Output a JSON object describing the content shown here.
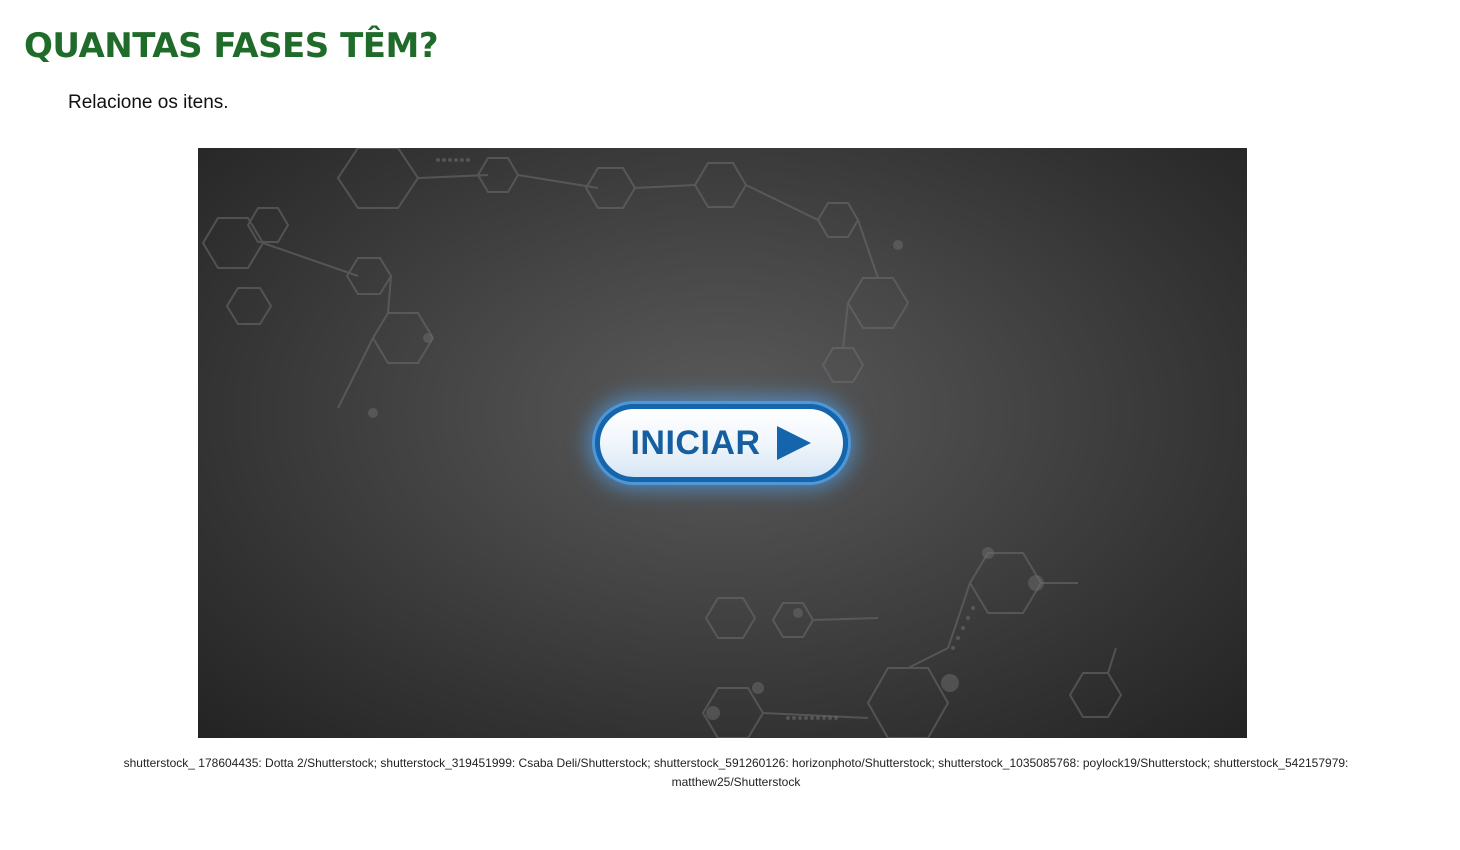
{
  "header": {
    "title": "QUANTAS FASES TÊM?",
    "instruction": "Relacione os itens."
  },
  "activity": {
    "start_label": "INICIAR",
    "play_icon": "play-triangle-icon",
    "background_icon": "molecule-hexagon-pattern"
  },
  "credits": {
    "text": "shutterstock_ 178604435: Dotta 2/Shutterstock; shutterstock_319451999: Csaba Deli/Shutterstock; shutterstock_591260126: horizonphoto/Shutterstock; shutterstock_1035085768: poylock19/Shutterstock; shutterstock_542157979: matthew25/Shutterstock"
  },
  "colors": {
    "title": "#1f6b2a",
    "button_border": "#1565ad",
    "button_text": "#155e9f",
    "stage_center": "#5a5a5a",
    "stage_edge": "#232323"
  }
}
